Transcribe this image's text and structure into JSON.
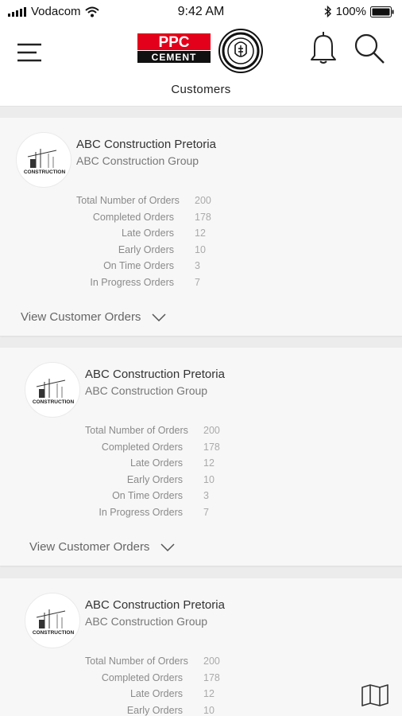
{
  "status_bar": {
    "carrier": "Vodacom",
    "time": "9:42 AM",
    "battery": "100%"
  },
  "header": {
    "logo_line1": "PPC",
    "logo_line2": "CEMENT",
    "title": "Customers"
  },
  "icons": {
    "menu": "hamburger-menu-icon",
    "notifications": "bell-icon",
    "search": "search-icon",
    "map": "map-icon",
    "expand": "chevron-down-icon"
  },
  "customers": [
    {
      "name": "ABC Construction Pretoria",
      "group": "ABC Construction Group",
      "avatar_text": "CONSTRUCTION",
      "stats": [
        {
          "label": "Total Number of Orders",
          "value": "200"
        },
        {
          "label": "Completed Orders",
          "value": "178"
        },
        {
          "label": "Late Orders",
          "value": "12"
        },
        {
          "label": "Early Orders",
          "value": "10"
        },
        {
          "label": "On Time Orders",
          "value": "3"
        },
        {
          "label": "In Progress Orders",
          "value": "7"
        }
      ],
      "action": "View Customer Orders"
    },
    {
      "name": "ABC Construction Pretoria",
      "group": "ABC Construction Group",
      "avatar_text": "CONSTRUCTION",
      "stats": [
        {
          "label": "Total Number of Orders",
          "value": "200"
        },
        {
          "label": "Completed Orders",
          "value": "178"
        },
        {
          "label": "Late Orders",
          "value": "12"
        },
        {
          "label": "Early Orders",
          "value": "10"
        },
        {
          "label": "On Time Orders",
          "value": "3"
        },
        {
          "label": "In Progress Orders",
          "value": "7"
        }
      ],
      "action": "View Customer Orders"
    },
    {
      "name": "ABC Construction Pretoria",
      "group": "ABC Construction Group",
      "avatar_text": "CONSTRUCTION",
      "stats": [
        {
          "label": "Total Number of Orders",
          "value": "200"
        },
        {
          "label": "Completed Orders",
          "value": "178"
        },
        {
          "label": "Late Orders",
          "value": "12"
        },
        {
          "label": "Early Orders",
          "value": "10"
        }
      ]
    }
  ],
  "colors": {
    "brand_red": "#e3001b",
    "brand_black": "#111111",
    "card_background": "#f7f7f7",
    "page_background": "#ececec"
  }
}
